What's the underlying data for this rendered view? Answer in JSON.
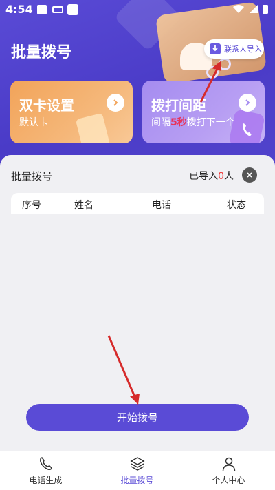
{
  "status_bar": {
    "time": "4:54"
  },
  "header": {
    "title": "批量拨号",
    "import_button": "联系人导入"
  },
  "cards": {
    "dual_sim": {
      "title": "双卡设置",
      "subtitle": "默认卡"
    },
    "interval": {
      "title": "拨打间距",
      "prefix": "间隔",
      "seconds": "5秒",
      "suffix": "拨打下一个"
    }
  },
  "panel": {
    "title": "批量拨号",
    "imported_prefix": "已导入",
    "imported_count": "0",
    "imported_suffix": "人",
    "columns": [
      "序号",
      "姓名",
      "电话",
      "状态"
    ]
  },
  "start_button": "开始拨号",
  "tabs": [
    {
      "label": "电话生成",
      "icon": "phone-icon"
    },
    {
      "label": "批量拨号",
      "icon": "layers-icon",
      "active": true
    },
    {
      "label": "个人中心",
      "icon": "person-icon"
    }
  ],
  "colors": {
    "primary": "#5a4bd6",
    "accent_red": "#e33",
    "annotation_arrow": "#d62b2b"
  }
}
